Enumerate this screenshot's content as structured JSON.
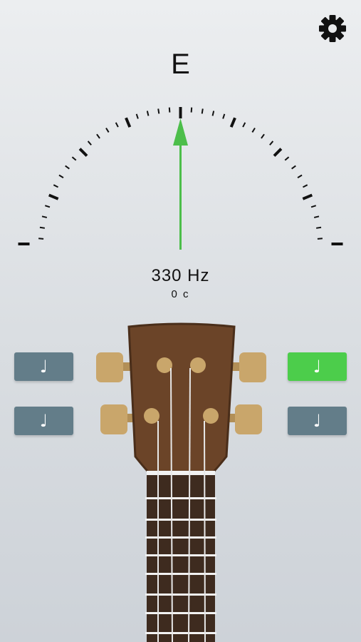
{
  "tuner": {
    "note": "E",
    "frequency_text": "330 Hz",
    "cents_text": "0 c",
    "needle_offset_cents": 0,
    "needle_color": "#4cbe4a"
  },
  "settings": {
    "icon": "gear-icon"
  },
  "strings": [
    {
      "id": "string-1",
      "side": "left",
      "row": "top",
      "active": false,
      "icon": "music-note-icon"
    },
    {
      "id": "string-2",
      "side": "left",
      "row": "bottom",
      "active": false,
      "icon": "music-note-icon"
    },
    {
      "id": "string-3",
      "side": "right",
      "row": "top",
      "active": true,
      "icon": "music-note-icon"
    },
    {
      "id": "string-4",
      "side": "right",
      "row": "bottom",
      "active": false,
      "icon": "music-note-icon"
    }
  ],
  "colors": {
    "button_default": "#637d89",
    "button_active": "#4ccd4b",
    "headstock": "#6b4428",
    "tuning_pegs": "#c9a66b",
    "fretboard": "#3e2b1f"
  }
}
